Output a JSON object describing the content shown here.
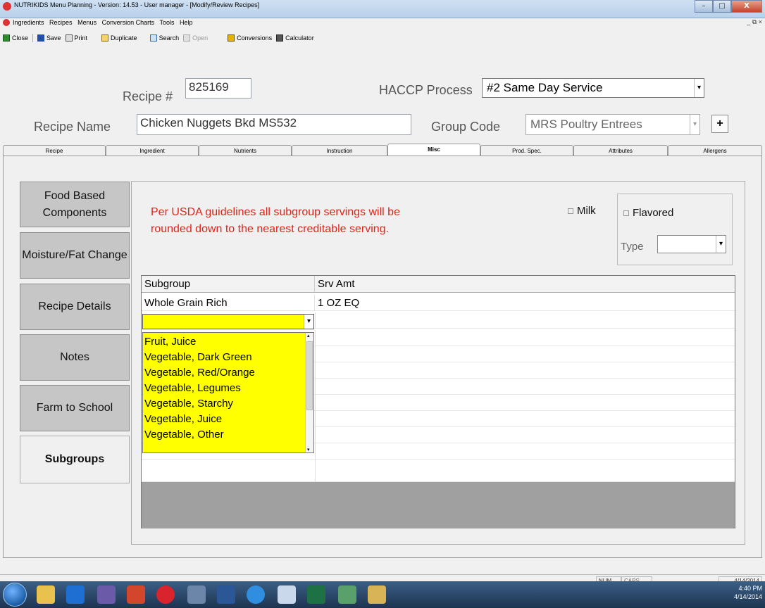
{
  "window": {
    "title": "NUTRIKIDS Menu Planning - Version: 14.53 - User manager - [Modify/Review Recipes]",
    "min_glyph": "–",
    "max_glyph": "□",
    "close_glyph": "X"
  },
  "menu": [
    "Ingredients",
    "Recipes",
    "Menus",
    "Conversion Charts",
    "Tools",
    "Help"
  ],
  "mdi_controls": "_ ⧉ ×",
  "toolbar": {
    "close": "Close",
    "save": "Save",
    "print": "Print",
    "duplicate": "Duplicate",
    "search": "Search",
    "open": "Open",
    "conversions": "Conversions",
    "calculator": "Calculator"
  },
  "form": {
    "recipe_num_label": "Recipe #",
    "recipe_num_value": "825169",
    "haccp_label": "HACCP Process",
    "haccp_value": "#2 Same Day Service",
    "recipe_name_label": "Recipe Name",
    "recipe_name_value": "Chicken Nuggets Bkd MS532",
    "group_code_label": "Group Code",
    "group_code_value": "MRS Poultry Entrees",
    "add_button": "+"
  },
  "tabs": [
    "Recipe",
    "Ingredient",
    "Nutrients",
    "Instruction",
    "Misc",
    "Prod. Spec.",
    "Attributes",
    "Allergens"
  ],
  "active_tab": "Misc",
  "sidebar": {
    "items": [
      "Food Based Components",
      "Moisture/Fat Change",
      "Recipe Details",
      "Notes",
      "Farm to School",
      "Subgroups"
    ],
    "active": "Subgroups"
  },
  "subgroups": {
    "notice_line1": "Per USDA guidelines all subgroup servings will be",
    "notice_line2": "rounded down to the nearest creditable serving.",
    "milk_label": "Milk",
    "flavored_label": "Flavored",
    "type_label": "Type",
    "type_value": "",
    "columns": [
      "Subgroup",
      "Srv Amt"
    ],
    "rows": [
      {
        "subgroup": "Whole Grain Rich",
        "srv_amt": "1 OZ EQ"
      }
    ],
    "new_row_value": "",
    "dropdown_options": [
      "Fruit, Juice",
      "Vegetable, Dark Green",
      "Vegetable, Red/Orange",
      "Vegetable, Legumes",
      "Vegetable, Starchy",
      "Vegetable, Juice",
      "Vegetable, Other"
    ]
  },
  "statusbar": {
    "num": "NUM",
    "caps": "CAPS",
    "date": "4/14/2014"
  },
  "taskbar": {
    "time": "4:40 PM",
    "date": "4/14/2014"
  },
  "colors": {
    "notice": "#e2231a",
    "highlight": "#ffff00",
    "taskbar": "#1d3450"
  }
}
